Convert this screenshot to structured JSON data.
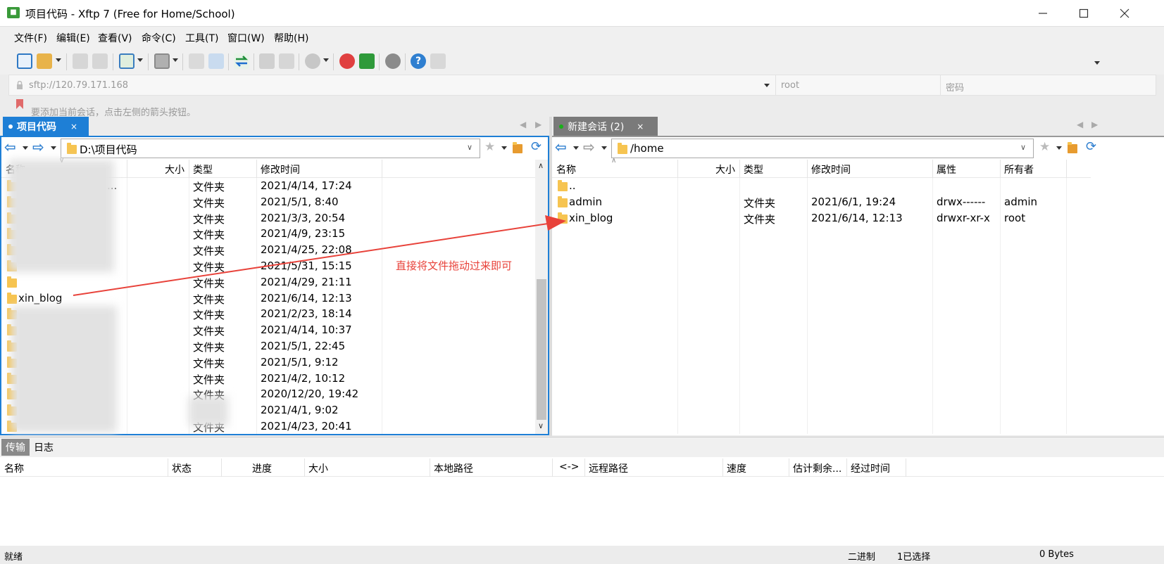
{
  "window": {
    "title": "项目代码 - Xftp 7 (Free for Home/School)",
    "app_icon": "xftp-logo-icon",
    "buttons": [
      "minimize",
      "maximize",
      "close"
    ]
  },
  "menu": [
    "文件(F)",
    "编辑(E)",
    "查看(V)",
    "命令(C)",
    "工具(T)",
    "窗口(W)",
    "帮助(H)"
  ],
  "address": {
    "url": "sftp://120.79.171.168",
    "user_placeholder": "root",
    "password_placeholder": "密码"
  },
  "hint": "要添加当前会话，点击左侧的箭头按钮。",
  "left_pane": {
    "tab_label": "项目代码",
    "path": "D:\\项目代码",
    "columns": [
      "名称",
      "大小",
      "类型",
      "修改时间"
    ],
    "rows": [
      {
        "name": "...",
        "type": "文件夹",
        "modified": "2021/4/14, 17:24"
      },
      {
        "name": "",
        "type": "文件夹",
        "modified": "2021/5/1, 8:40"
      },
      {
        "name": "",
        "type": "文件夹",
        "modified": "2021/3/3, 20:54"
      },
      {
        "name": "",
        "type": "文件夹",
        "modified": "2021/4/9, 23:15"
      },
      {
        "name": "",
        "type": "文件夹",
        "modified": "2021/4/25, 22:08"
      },
      {
        "name": "",
        "type": "文件夹",
        "modified": "2021/5/31, 15:15"
      },
      {
        "name": "",
        "type": "文件夹",
        "modified": "2021/4/29, 21:11"
      },
      {
        "name": "xin_blog",
        "type": "文件夹",
        "modified": "2021/6/14, 12:13"
      },
      {
        "name": "",
        "type": "文件夹",
        "modified": "2021/2/23, 18:14"
      },
      {
        "name": "",
        "type": "文件夹",
        "modified": "2021/4/14, 10:37"
      },
      {
        "name": "",
        "type": "文件夹",
        "modified": "2021/5/1, 22:45"
      },
      {
        "name": "",
        "type": "文件夹",
        "modified": "2021/5/1, 9:12"
      },
      {
        "name": "",
        "type": "文件夹",
        "modified": "2021/4/2, 10:12"
      },
      {
        "name": "",
        "type": "文件夹",
        "modified": "2020/12/20, 19:42"
      },
      {
        "name": "",
        "type": "",
        "modified": "2021/4/1, 9:02"
      },
      {
        "name": "",
        "type": "文件夹",
        "modified": "2021/4/23, 20:41"
      }
    ]
  },
  "right_pane": {
    "tab_label": "新建会话 (2)",
    "path": "/home",
    "columns": [
      "名称",
      "大小",
      "类型",
      "修改时间",
      "属性",
      "所有者"
    ],
    "rows": [
      {
        "name": "..",
        "type": "",
        "modified": "",
        "attr": "",
        "owner": ""
      },
      {
        "name": "admin",
        "type": "文件夹",
        "modified": "2021/6/1, 19:24",
        "attr": "drwx------",
        "owner": "admin"
      },
      {
        "name": "xin_blog",
        "type": "文件夹",
        "modified": "2021/6/14, 12:13",
        "attr": "drwxr-xr-x",
        "owner": "root"
      }
    ]
  },
  "annotation": {
    "text": "直接将文件拖动过来即可",
    "color": "#e8423a"
  },
  "transfer": {
    "tabs": [
      "传输",
      "日志"
    ],
    "columns": [
      "名称",
      "状态",
      "进度",
      "大小",
      "本地路径",
      "<->",
      "远程路径",
      "速度",
      "估计剩余...",
      "经过时间"
    ]
  },
  "status": {
    "left": "就绪",
    "mode": "二进制",
    "selected": "1已选择",
    "size": "0 Bytes"
  },
  "colors": {
    "accent_blue": "#1e7fd6",
    "folder_yellow": "#f6c451",
    "session_dot": "#19b019"
  }
}
